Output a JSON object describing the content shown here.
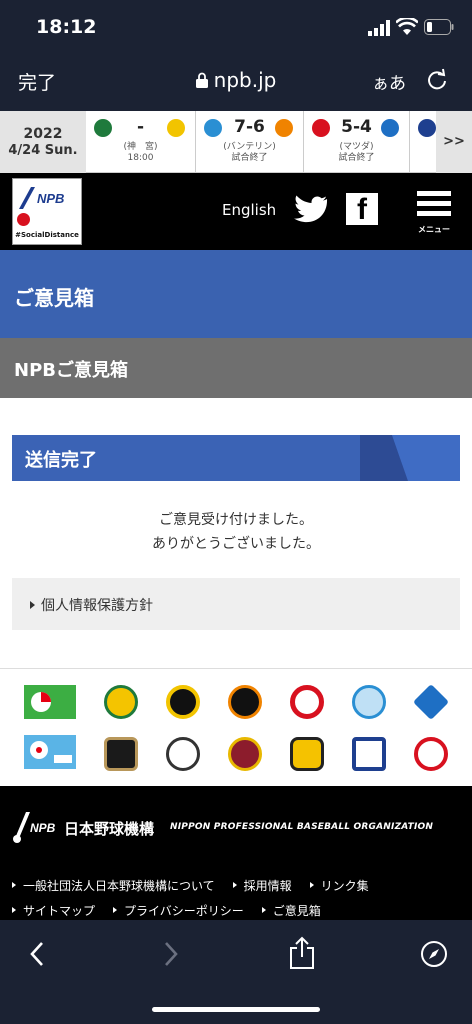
{
  "status": {
    "time": "18:12"
  },
  "browser": {
    "done": "完了",
    "url": "npb.jp",
    "text_size": "ぁあ"
  },
  "ticker": {
    "year": "2022",
    "date": "4/24 Sun.",
    "more": ">>",
    "games": [
      {
        "score": "-",
        "venue": "(神　宮)",
        "status": "18:00",
        "left_color": "#1f7a3c",
        "right_color": "#f2c400"
      },
      {
        "score": "7-6",
        "venue": "(バンテリン)",
        "status": "試合終了",
        "left_color": "#2a8fd3",
        "right_color": "#f08300"
      },
      {
        "score": "5-4",
        "venue": "(マツダ)",
        "status": "試合終了",
        "left_color": "#d8111f",
        "right_color": "#1e6fc4"
      }
    ]
  },
  "header": {
    "logo_tag": "#SocialDistance",
    "english": "English",
    "menu": "メニュー"
  },
  "page": {
    "banner": "ご意見箱",
    "subtitle": "NPBご意見箱",
    "section_title": "送信完了",
    "message_line1": "ご意見受け付けました。",
    "message_line2": "ありがとうございました。",
    "privacy_link": "個人情報保護方針"
  },
  "team_logos": {
    "row1": [
      "central-league",
      "swallows",
      "tigers",
      "giants",
      "carp",
      "dragons",
      "baystars"
    ],
    "row2": [
      "pacific-league",
      "buffaloes",
      "marines",
      "eagles",
      "hawks",
      "fighters",
      "lions"
    ]
  },
  "footer": {
    "org_jp": "日本野球機構",
    "org_en": "NIPPON PROFESSIONAL BASEBALL ORGANIZATION",
    "links": [
      "一般社団法人日本野球機構について",
      "採用情報",
      "リンク集",
      "サイトマップ",
      "プライバシーポリシー",
      "ご意見箱"
    ]
  }
}
